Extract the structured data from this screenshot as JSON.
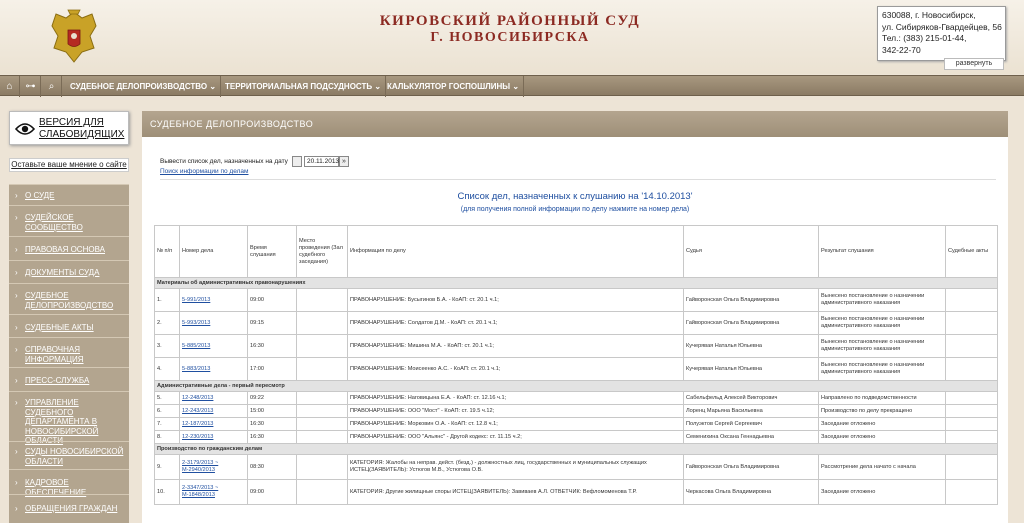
{
  "header": {
    "court_name": "КИРОВСКИЙ РАЙОННЫЙ СУД",
    "city": "Г. НОВОСИБИРСКА",
    "contacts": [
      "630088, г. Новосибирск,",
      "ул. Сибиряков-Гвардейцев, 56",
      "Тел.: (383) 215-01-44,",
      "342-22-70"
    ],
    "expand_label": "развернуть"
  },
  "nav": {
    "icons": [
      "home-icon",
      "sitemap-icon",
      "search-icon"
    ],
    "items": [
      {
        "label": "СУДЕБНОЕ ДЕЛОПРОИЗВОДСТВО"
      },
      {
        "label": "ТЕРРИТОРИАЛЬНАЯ ПОДСУДНОСТЬ"
      },
      {
        "label": "КАЛЬКУЛЯТОР ГОСПОШЛИНЫ"
      }
    ]
  },
  "sidebar": {
    "accessibility": "ВЕРСИЯ ДЛЯ СЛАБОВИДЯЩИХ",
    "feedback": "Оставьте ваше мнение о сайте",
    "items": [
      {
        "label": "О СУДЕ"
      },
      {
        "label": "СУДЕЙСКОЕ СООБЩЕСТВО"
      },
      {
        "label": "ПРАВОВАЯ ОСНОВА"
      },
      {
        "label": "ДОКУМЕНТЫ СУДА"
      },
      {
        "label": "СУДЕБНОЕ ДЕЛОПРОИЗВОДСТВО"
      },
      {
        "label": "СУДЕБНЫЕ АКТЫ"
      },
      {
        "label": "СПРАВОЧНАЯ ИНФОРМАЦИЯ"
      },
      {
        "label": "ПРЕСС-СЛУЖБА"
      },
      {
        "label": "УПРАВЛЕНИЕ СУДЕБНОГО ДЕПАРТАМЕНТА В НОВОСИБИРСКОЙ ОБЛАСТИ"
      },
      {
        "label": "СУДЫ НОВОСИБИРСКОЙ ОБЛАСТИ"
      },
      {
        "label": "КАДРОВОЕ ОБЕСПЕЧЕНИЕ"
      },
      {
        "label": "ОБРАЩЕНИЯ ГРАЖДАН"
      }
    ]
  },
  "content": {
    "section_title": "СУДЕБНОЕ ДЕЛОПРОИЗВОДСТВО",
    "date_label": "Вывести список дел, назначенных на дату",
    "date_value": "20.11.2013",
    "go_label": "»",
    "search_link": "Поиск информации по делам",
    "list_title": "Список дел, назначенных к слушанию на '14.10.2013'",
    "list_subtitle": "(для получения полной информации по делу нажмите на номер дела)"
  },
  "table": {
    "headers": [
      "№ п/п",
      "Номер дела",
      "Время слушания",
      "Место проведения (Зал судебного заседания)",
      "Информация по делу",
      "Судья",
      "Результат слушания",
      "Судебные акты"
    ],
    "groups": [
      {
        "title": "Материалы об административных правонарушениях",
        "rows": [
          {
            "n": "1.",
            "case": "5-991/2013",
            "time": "09:00",
            "place": "",
            "info": "ПРАВОНАРУШЕНИЕ: Бусыгинов Б.А. - КоАП: ст. 20.1 ч.1;",
            "judge": "Гайворонская Ольга Владимировна",
            "result": "Вынесено постановление о назначении административного наказания",
            "acts": ""
          },
          {
            "n": "2.",
            "case": "5-993/2013",
            "time": "09:15",
            "place": "",
            "info": "ПРАВОНАРУШЕНИЕ: Солдатов Д.М. - КоАП: ст. 20.1 ч.1;",
            "judge": "Гайворонская Ольга Владимировна",
            "result": "Вынесено постановление о назначении административного наказания",
            "acts": ""
          },
          {
            "n": "3.",
            "case": "5-885/2013",
            "time": "16:30",
            "place": "",
            "info": "ПРАВОНАРУШЕНИЕ: Мишина М.А. - КоАП: ст. 20.1 ч.1;",
            "judge": "Кучерявая Наталья Юльевна",
            "result": "Вынесено постановление о назначении административного наказания",
            "acts": ""
          },
          {
            "n": "4.",
            "case": "5-883/2013",
            "time": "17:00",
            "place": "",
            "info": "ПРАВОНАРУШЕНИЕ: Моисеенко А.С. - КоАП: ст. 20.1 ч.1;",
            "judge": "Кучерявая Наталья Юльевна",
            "result": "Вынесено постановление о назначении административного наказания",
            "acts": ""
          }
        ]
      },
      {
        "title": "Административные дела - первый пересмотр",
        "rows": [
          {
            "n": "5.",
            "case": "12-248/2013",
            "time": "09:22",
            "place": "",
            "info": "ПРАВОНАРУШЕНИЕ: Наговицына Е.А. - КоАП: ст. 12.16 ч.1;",
            "judge": "Сабельфельд Алексей Викторович",
            "result": "Направлено по подведомственности",
            "acts": ""
          },
          {
            "n": "6.",
            "case": "12-243/2013",
            "time": "15:00",
            "place": "",
            "info": "ПРАВОНАРУШЕНИЕ: ООО \"Мост\" - КоАП: ст. 19.5 ч.12;",
            "judge": "Лоренц Марьяна Васильевна",
            "result": "Производство по делу прекращено",
            "acts": ""
          },
          {
            "n": "7.",
            "case": "12-187/2013",
            "time": "16:30",
            "place": "",
            "info": "ПРАВОНАРУШЕНИЕ: Морковин О.А. - КоАП: ст. 12.8 ч.1;",
            "judge": "Полуэктов Сергей Сергеевич",
            "result": "Заседание отложено",
            "acts": ""
          },
          {
            "n": "8.",
            "case": "12-230/2013",
            "time": "16:30",
            "place": "",
            "info": "ПРАВОНАРУШЕНИЕ: ООО \"Альянс\" - Другой кодекс: ст. 11.15 ч.2;",
            "judge": "Семенихина Оксана Геннадьевна",
            "result": "Заседание отложено",
            "acts": ""
          }
        ]
      },
      {
        "title": "Производство по гражданским делам",
        "rows": [
          {
            "n": "9.",
            "case": "2-3179/2013 ~ М-2940/2013",
            "time": "08:30",
            "place": "",
            "info": "КАТЕГОРИЯ: Жалобы на неправ. дейст. (безд.) - должностных лиц, государственных и муниципальных служащих ИСТЕЦ(ЗАЯВИТЕЛЬ): Устюгов М.В., Устюгова О.В.",
            "judge": "Гайворонская Ольга Владимировна",
            "result": "Рассмотрение дела начато с начала",
            "acts": ""
          },
          {
            "n": "10.",
            "case": "2-3347/2013 ~ М-1848/2013",
            "time": "09:00",
            "place": "",
            "info": "КАТЕГОРИЯ: Другие жилищные споры ИСТЕЦ(ЗАЯВИТЕЛЬ): Завиваев А.Л. ОТВЕТЧИК: Вефломоменова Т.Р.",
            "judge": "Черкасова Ольга Владимировна",
            "result": "Заседание отложено",
            "acts": ""
          }
        ]
      }
    ]
  }
}
